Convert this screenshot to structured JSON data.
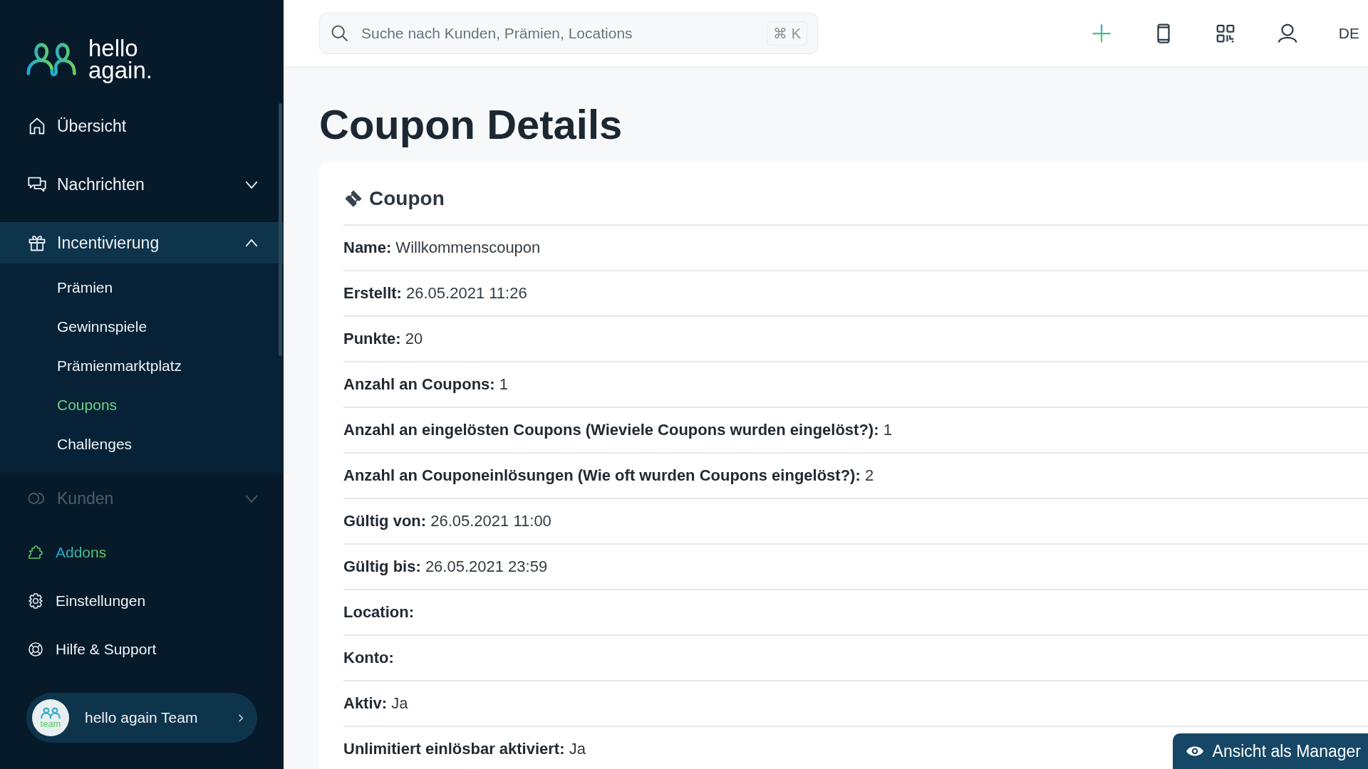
{
  "brand": {
    "line_1": "hello",
    "line_2": "again."
  },
  "nav": {
    "items": [
      {
        "label": "Übersicht",
        "faded": false
      },
      {
        "label": "Nachrichten",
        "expanded": false,
        "faded": false
      },
      {
        "label": "Incentivierung",
        "expanded": true,
        "faded": false,
        "children": [
          {
            "label": "Prämien",
            "selected": false
          },
          {
            "label": "Gewinnspiele",
            "selected": false
          },
          {
            "label": "Prämienmarktplatz",
            "selected": false
          },
          {
            "label": "Coupons",
            "selected": true
          },
          {
            "label": "Challenges",
            "selected": false
          }
        ]
      },
      {
        "label": "Kunden",
        "expanded": false,
        "faded": true
      }
    ],
    "footer_items": [
      {
        "label": "Addons",
        "highlighted": true
      },
      {
        "label": "Einstellungen",
        "highlighted": false
      },
      {
        "label": "Hilfe & Support",
        "highlighted": false
      }
    ],
    "account": {
      "avatar_text": "team",
      "name": "hello again Team"
    }
  },
  "search": {
    "placeholder": "Suche nach Kunden, Prämien, Locations",
    "shortcut": "⌘ K"
  },
  "toolbar": {
    "language": "DE"
  },
  "page": {
    "title": "Coupon Details"
  },
  "card": {
    "title": "Coupon",
    "rows": [
      {
        "label": "Name:",
        "value": "Willkommenscoupon"
      },
      {
        "label": "Erstellt:",
        "value": "26.05.2021 11:26"
      },
      {
        "label": "Punkte:",
        "value": "20"
      },
      {
        "label": "Anzahl an Coupons:",
        "value": "1"
      },
      {
        "label": "Anzahl an eingelösten Coupons (Wieviele Coupons wurden eingelöst?):",
        "value": "1"
      },
      {
        "label": "Anzahl an Couponeinlösungen (Wie oft wurden Coupons eingelöst?):",
        "value": "2"
      },
      {
        "label": "Gültig von:",
        "value": "26.05.2021 11:00"
      },
      {
        "label": "Gültig bis:",
        "value": "26.05.2021 23:59"
      },
      {
        "label": "Location:"
      },
      {
        "label": "Konto:"
      },
      {
        "label": "Aktiv:",
        "value": "Ja"
      },
      {
        "label": "Unlimitiert einlösbar aktiviert:",
        "value": "Ja"
      }
    ]
  },
  "manager_button": {
    "label": "Ansicht als Manager"
  }
}
